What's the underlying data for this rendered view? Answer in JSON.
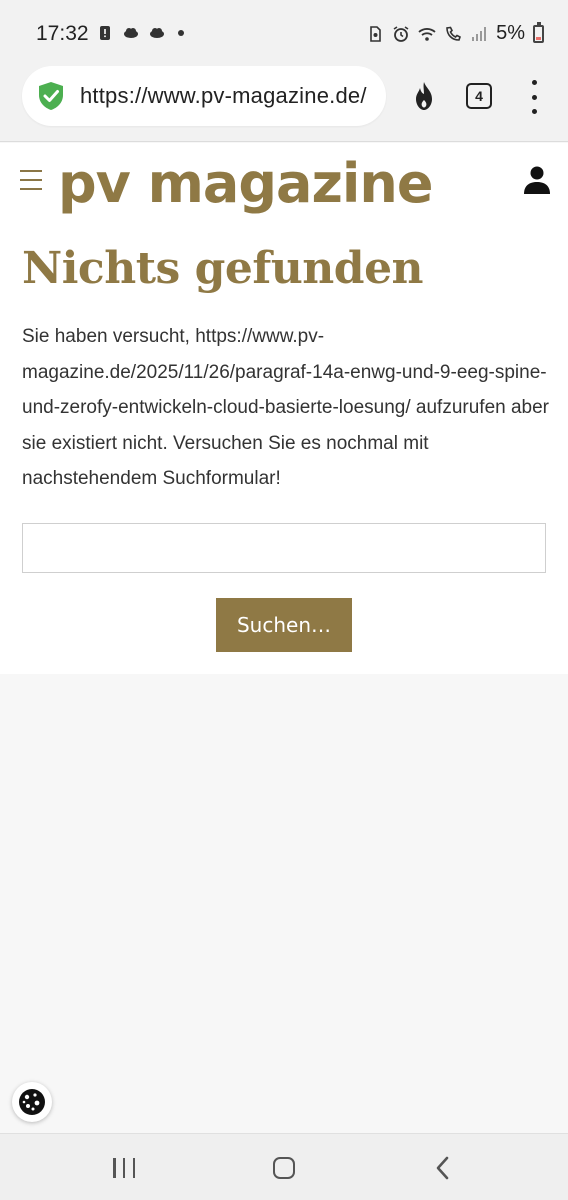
{
  "status_bar": {
    "time": "17:32",
    "battery_percent": "5%",
    "left_icons": [
      "alert-icon",
      "weather-icon",
      "weather-icon"
    ],
    "right_icons": [
      "sim-icon",
      "alarm-icon",
      "wifi-icon",
      "call-icon",
      "signal-icon",
      "battery-icon"
    ]
  },
  "browser": {
    "url": "https://www.pv-magazine.de/",
    "tab_count": "4",
    "icons": [
      "shield-icon",
      "flame-icon",
      "tabs-icon",
      "menu-icon"
    ]
  },
  "site": {
    "logo": "pv magazine",
    "heading": "Nichts gefunden",
    "message": "Sie haben versucht, https://www.pv-magazine.de/2025/11/26/paragraf-14a-enwg-und-9-eeg-spine-und-zerofy-entwickeln-cloud-basierte-loesung/ aufzurufen aber sie existiert nicht. Versuchen Sie es nochmal mit nachstehendem Suchformular!",
    "search_value": "",
    "search_button": "Suchen…"
  },
  "colors": {
    "brand": "#8f7945",
    "shield_green": "#4caf50",
    "battery_low": "#e9706b"
  }
}
